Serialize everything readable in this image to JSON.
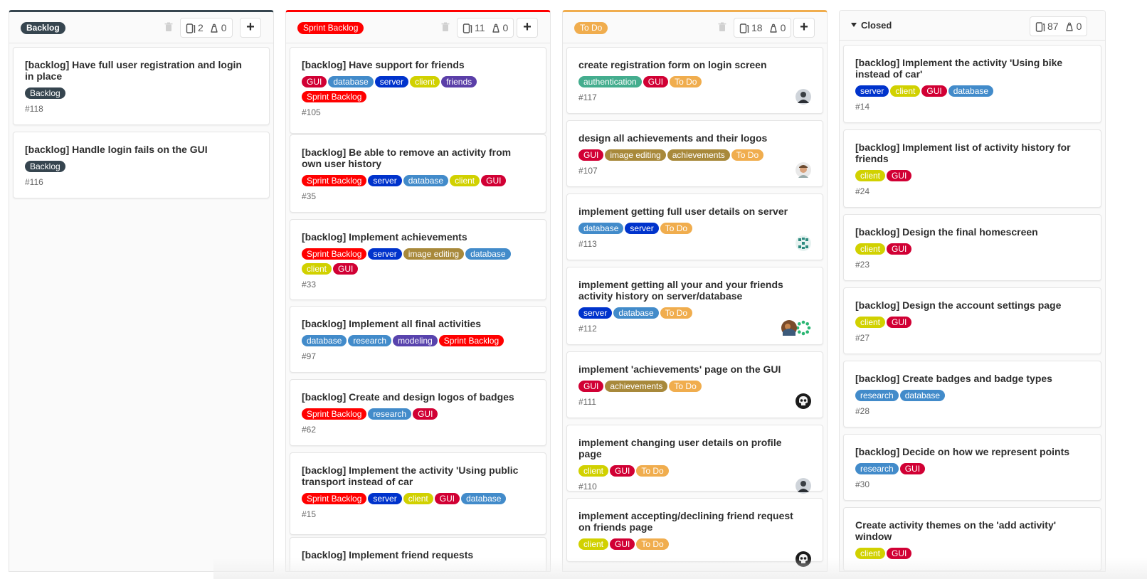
{
  "colors": {
    "Backlog": "#36454f",
    "Sprint Backlog": "#ff0000",
    "To Do": "#f0ad4e",
    "GUI": "#d10034",
    "database": "#428bca",
    "server": "#0033cc",
    "client": "#d1d100",
    "friends": "#5b3fa8",
    "authentication": "#44ad8e",
    "image editing": "#a8893b",
    "achievements": "#a8893b",
    "research": "#428bca",
    "modeling": "#5843ad"
  },
  "columns": [
    {
      "title": "Backlog",
      "title_style": "label",
      "border_color": "#36454f",
      "issue_count": "2",
      "weight": "0",
      "cards": [
        {
          "title": "[backlog] Have full user registration and login in place",
          "labels": [
            "Backlog"
          ],
          "number": "#118"
        },
        {
          "title": "[backlog] Handle login fails on the GUI",
          "labels": [
            "Backlog"
          ],
          "number": "#116"
        }
      ]
    },
    {
      "title": "Sprint Backlog",
      "title_style": "label",
      "border_color": "#ff0000",
      "issue_count": "11",
      "weight": "0",
      "cards": [
        {
          "title": "[backlog] Have support for friends",
          "labels": [
            "GUI",
            "database",
            "server",
            "client",
            "friends",
            "Sprint Backlog"
          ],
          "number": "#105"
        },
        {
          "title": "[backlog] Be able to remove an activity from own user history",
          "labels": [
            "Sprint Backlog",
            "server",
            "database",
            "client",
            "GUI"
          ],
          "number": "#35"
        },
        {
          "title": "[backlog] Implement achievements",
          "labels": [
            "Sprint Backlog",
            "server",
            "image editing",
            "database",
            "client",
            "GUI"
          ],
          "number": "#33"
        },
        {
          "title": "[backlog] Implement all final activities",
          "labels": [
            "database",
            "research",
            "modeling",
            "Sprint Backlog"
          ],
          "number": "#97"
        },
        {
          "title": "[backlog] Create and design logos of badges",
          "labels": [
            "Sprint Backlog",
            "research",
            "GUI"
          ],
          "number": "#62"
        },
        {
          "title": "[backlog] Implement the activity 'Using public transport instead of car",
          "labels": [
            "Sprint Backlog",
            "server",
            "client",
            "GUI",
            "database"
          ],
          "number": "#15"
        },
        {
          "title": "[backlog] Implement friend requests",
          "labels": [],
          "number": ""
        }
      ]
    },
    {
      "title": "To Do",
      "title_style": "label",
      "border_color": "#f0ad4e",
      "issue_count": "18",
      "weight": "0",
      "cards": [
        {
          "title": "create registration form on login screen",
          "labels": [
            "authentication",
            "GUI",
            "To Do"
          ],
          "number": "#117",
          "avatars": [
            "person"
          ]
        },
        {
          "title": "design all achievements and their logos",
          "labels": [
            "GUI",
            "image editing",
            "achievements",
            "To Do"
          ],
          "number": "#107",
          "avatars": [
            "face"
          ]
        },
        {
          "title": "implement getting full user details on server",
          "labels": [
            "database",
            "server",
            "To Do"
          ],
          "number": "#113",
          "avatars": [
            "pattern"
          ]
        },
        {
          "title": "implement getting all your and your friends activity history on server/database",
          "labels": [
            "server",
            "database",
            "To Do"
          ],
          "number": "#112",
          "avatars": [
            "photo",
            "ring"
          ]
        },
        {
          "title": "implement 'achievements' page on the GUI",
          "labels": [
            "GUI",
            "achievements",
            "To Do"
          ],
          "number": "#111",
          "avatars": [
            "skull"
          ]
        },
        {
          "title": "implement changing user details on profile page",
          "labels": [
            "client",
            "GUI",
            "To Do"
          ],
          "number": "#110",
          "avatars": [
            "person"
          ]
        },
        {
          "title": "implement accepting/declining friend request on friends page",
          "labels": [
            "client",
            "GUI",
            "To Do"
          ],
          "number": "",
          "avatars": [
            "skull"
          ]
        }
      ]
    },
    {
      "title": "Closed",
      "title_style": "text",
      "border_color": "#e5e5e5",
      "issue_count": "87",
      "weight": "0",
      "cards": [
        {
          "title": "[backlog] Implement the activity 'Using bike instead of car'",
          "labels": [
            "server",
            "client",
            "GUI",
            "database"
          ],
          "number": "#14"
        },
        {
          "title": "[backlog] Implement list of activity history for friends",
          "labels": [
            "client",
            "GUI"
          ],
          "number": "#24"
        },
        {
          "title": "[backlog] Design the final homescreen",
          "labels": [
            "client",
            "GUI"
          ],
          "number": "#23"
        },
        {
          "title": "[backlog] Design the account settings page",
          "labels": [
            "client",
            "GUI"
          ],
          "number": "#27"
        },
        {
          "title": "[backlog] Create badges and badge types",
          "labels": [
            "research",
            "database"
          ],
          "number": "#28"
        },
        {
          "title": "[backlog] Decide on how we represent points",
          "labels": [
            "research",
            "GUI"
          ],
          "number": "#30"
        },
        {
          "title": "Create activity themes on the 'add activity' window",
          "labels": [
            "client",
            "GUI"
          ],
          "number": ""
        }
      ]
    }
  ]
}
